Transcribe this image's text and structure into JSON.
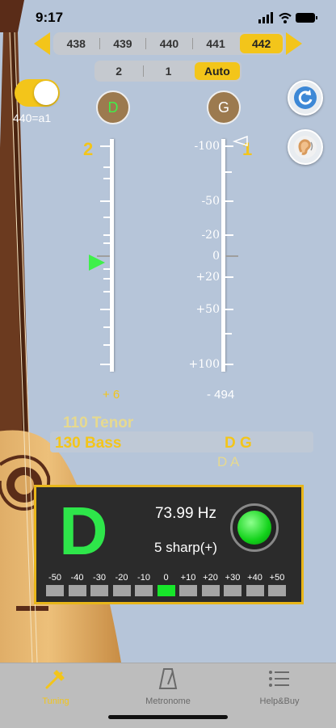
{
  "status": {
    "time": "9:17"
  },
  "frequency": {
    "options": [
      "438",
      "439",
      "440",
      "441",
      "442"
    ],
    "selected_index": 4
  },
  "mode": {
    "options": [
      "2",
      "1",
      "Auto"
    ],
    "selected_index": 2
  },
  "toggle": {
    "label": "440=a1",
    "on": true
  },
  "strings": [
    {
      "number": "2",
      "note": "D",
      "deviation": "+ 6"
    },
    {
      "number": "1",
      "note": "G",
      "deviation": "- 494"
    }
  ],
  "scale_labels": [
    "-100",
    "-50",
    "-20",
    "0",
    "+20",
    "+50",
    "+100"
  ],
  "tuning_list": {
    "items": [
      "110 Tenor",
      "130 Bass"
    ],
    "selected_notes": "D  G",
    "next_notes": "D  A"
  },
  "readout": {
    "note": "D",
    "frequency": "73.99 Hz",
    "cents": "5  sharp(+)",
    "segment_labels": [
      "-50",
      "-40",
      "-30",
      "-20",
      "-10",
      "0",
      "+10",
      "+20",
      "+30",
      "+40",
      "+50"
    ],
    "active_segment_index": 5
  },
  "tabs": [
    {
      "label": "Tuning",
      "icon": "tuning-fork-icon",
      "active": true
    },
    {
      "label": "Metronome",
      "icon": "metronome-icon",
      "active": false
    },
    {
      "label": "Help&Buy",
      "icon": "list-icon",
      "active": false
    }
  ],
  "colors": {
    "accent": "#f3c51a",
    "in_tune": "#17e62a",
    "background": "#b6c5d9"
  }
}
